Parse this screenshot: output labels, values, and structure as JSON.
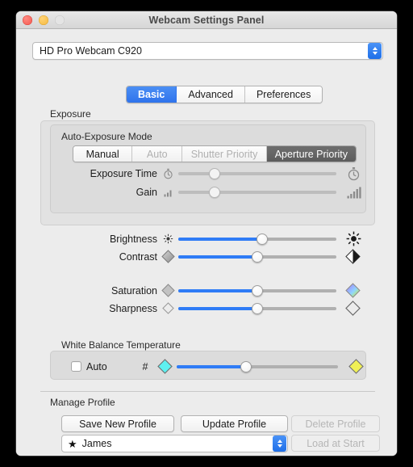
{
  "window": {
    "title": "Webcam Settings Panel",
    "traffic_lights": [
      {
        "name": "close",
        "color": "#f4564c",
        "enabled": true
      },
      {
        "name": "minimize",
        "color": "#f4b93f",
        "enabled": true
      },
      {
        "name": "zoom",
        "color": "#e4e4e4",
        "enabled": false
      }
    ]
  },
  "device": {
    "selected": "HD Pro Webcam C920",
    "icon": "chevron-updown-icon"
  },
  "tabs": [
    {
      "label": "Basic",
      "active": true
    },
    {
      "label": "Advanced",
      "active": false
    },
    {
      "label": "Preferences",
      "active": false
    }
  ],
  "exposure": {
    "group_label": "Exposure",
    "mode_label": "Auto-Exposure Mode",
    "modes": [
      {
        "label": "Manual",
        "state": "normal"
      },
      {
        "label": "Auto",
        "state": "disabled"
      },
      {
        "label": "Shutter Priority",
        "state": "disabled"
      },
      {
        "label": "Aperture Priority",
        "state": "selected"
      }
    ],
    "sliders": [
      {
        "label": "Exposure Time",
        "value_pct": 23,
        "enabled": false,
        "icon_left": "stopwatch-small-icon",
        "icon_right": "stopwatch-large-icon"
      },
      {
        "label": "Gain",
        "value_pct": 23,
        "enabled": false,
        "icon_left": "signal-bars-small-icon",
        "icon_right": "signal-bars-large-icon"
      }
    ]
  },
  "image_sliders": [
    {
      "label": "Brightness",
      "value_pct": 53,
      "enabled": true,
      "icon_left": "sun-small-icon",
      "icon_right": "sun-large-icon"
    },
    {
      "label": "Contrast",
      "value_pct": 50,
      "enabled": true,
      "icon_left": "contrast-gray-diamond-icon",
      "icon_right": "contrast-split-diamond-icon"
    },
    {
      "label": "Saturation",
      "value_pct": 50,
      "enabled": true,
      "icon_left": "saturation-gray-diamond-icon",
      "icon_right": "saturation-color-diamond-icon"
    },
    {
      "label": "Sharpness",
      "value_pct": 50,
      "enabled": true,
      "icon_left": "sharpness-outline-diamond-small-icon",
      "icon_right": "sharpness-outline-diamond-large-icon"
    }
  ],
  "white_balance": {
    "group_label": "White Balance Temperature",
    "auto_label": "Auto",
    "auto_checked": false,
    "hash_label": "#",
    "value_pct": 43,
    "enabled": true,
    "icon_left": "cyan-diamond-icon",
    "icon_right": "yellow-diamond-icon"
  },
  "manage_profile": {
    "group_label": "Manage Profile",
    "buttons": [
      {
        "label": "Save New Profile",
        "enabled": true
      },
      {
        "label": "Update Profile",
        "enabled": true
      },
      {
        "label": "Delete Profile",
        "enabled": false
      },
      {
        "label": "Load at Start",
        "enabled": false
      }
    ],
    "profile": {
      "selected": "James",
      "icon": "star-icon",
      "chevron": "chevron-updown-icon"
    }
  },
  "colors": {
    "accent_blue": "#2f7cf6",
    "tab_active_blue": "#2f73ec",
    "segment_selected_gray": "#5c5c5c",
    "window_bg": "#ececec",
    "group_bg": "#e2e2e2",
    "inner_group_bg": "#dcdcdc",
    "cyan_diamond": "#5ef0f0",
    "yellow_diamond": "#f0f055"
  }
}
